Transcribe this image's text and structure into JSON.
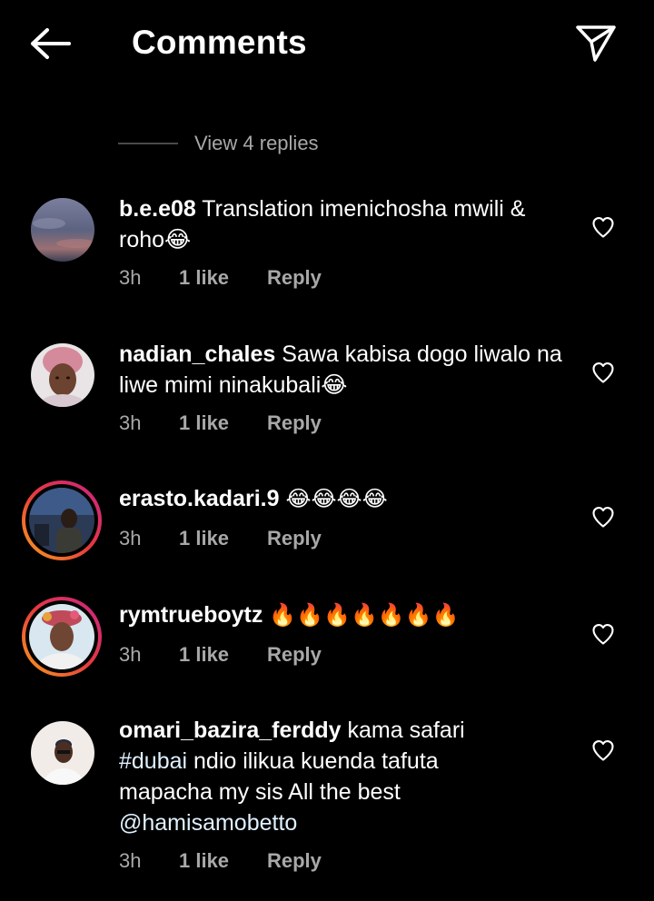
{
  "header": {
    "title": "Comments",
    "back_icon": "arrow-left-icon",
    "share_icon": "paper-plane-icon"
  },
  "replies_toggle": {
    "label": "View 4 replies"
  },
  "comments": [
    {
      "username": "b.e.e08",
      "text": "Translation imenichosha mwili & roho😂",
      "time": "3h",
      "likes": "1 like",
      "reply_label": "Reply",
      "has_story_ring": false
    },
    {
      "username": "nadian_chales",
      "text": "Sawa kabisa dogo liwalo na liwe mimi ninakubali😂",
      "time": "3h",
      "likes": "1 like",
      "reply_label": "Reply",
      "has_story_ring": false
    },
    {
      "username": "erasto.kadari.9",
      "text": "😂😂😂😂",
      "time": "3h",
      "likes": "1 like",
      "reply_label": "Reply",
      "has_story_ring": true
    },
    {
      "username": "rymtrueboytz",
      "text": "🔥🔥🔥🔥🔥🔥🔥",
      "time": "3h",
      "likes": "1 like",
      "reply_label": "Reply",
      "has_story_ring": true
    },
    {
      "username": "omari_bazira_ferddy",
      "text_before": "kama safari ",
      "hashtag": "#dubai",
      "text_middle": " ndio ilikua kuenda tafuta mapacha my sis All the best ",
      "mention": "@hamisamobetto",
      "time": "3h",
      "likes": "1 like",
      "reply_label": "Reply",
      "has_story_ring": false
    }
  ],
  "colors": {
    "background": "#000000",
    "primary_text": "#ffffff",
    "secondary_text": "#a8a8a8",
    "story_ring_start": "#f9a11b",
    "story_ring_end": "#c9248a"
  }
}
